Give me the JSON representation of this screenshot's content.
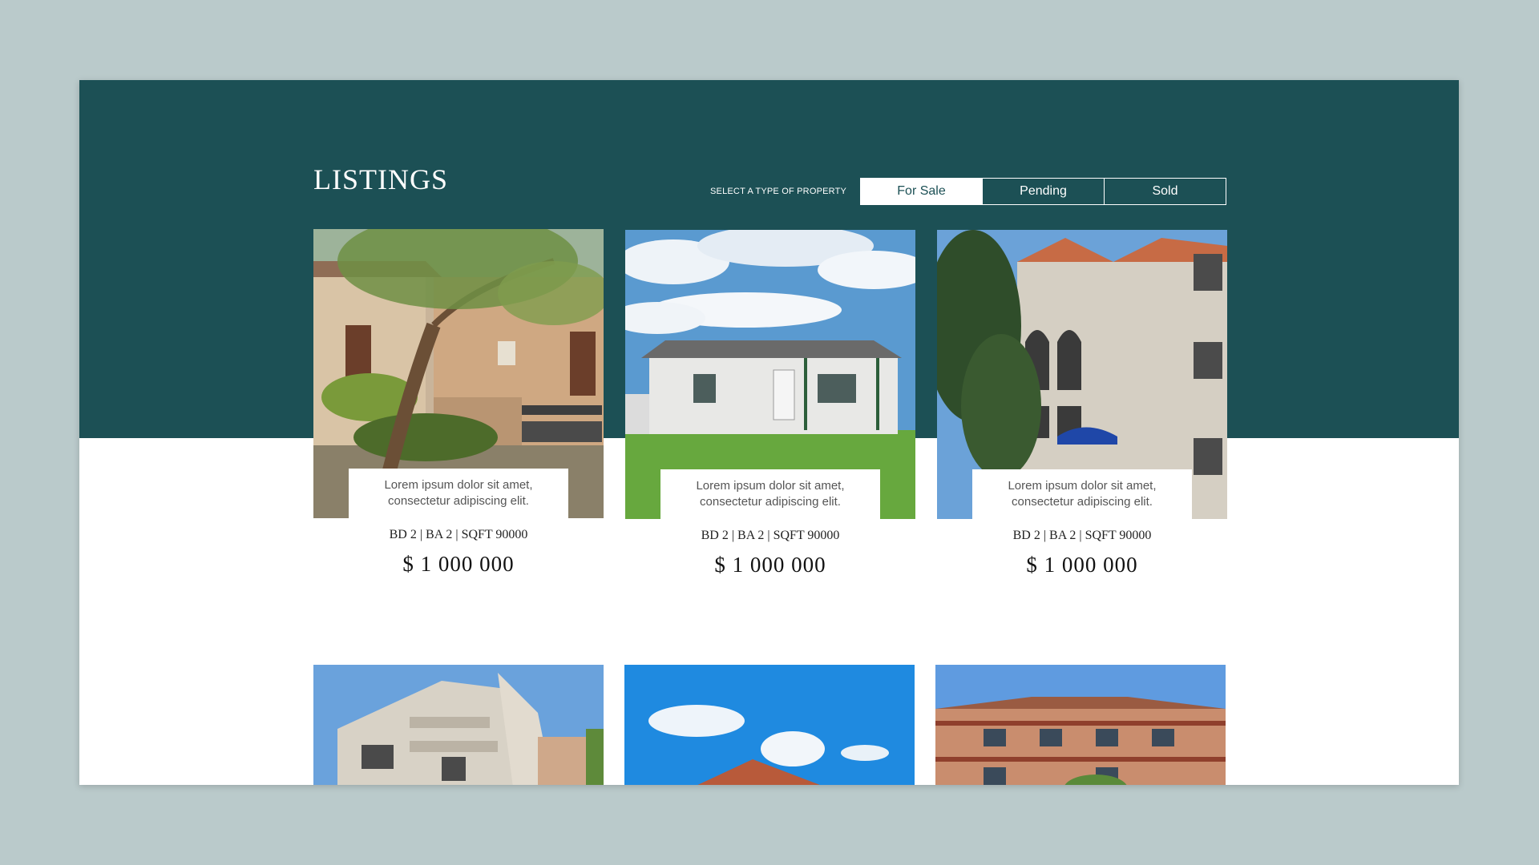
{
  "header": {
    "title": "LISTINGS",
    "filter_label": "SELECT A TYPE OF PROPERTY",
    "tabs": [
      {
        "label": "For Sale",
        "active": true
      },
      {
        "label": "Pending",
        "active": false
      },
      {
        "label": "Sold",
        "active": false
      }
    ]
  },
  "listings": [
    {
      "description": "Lorem ipsum dolor sit amet, consectetur adipiscing elit.",
      "specs": "BD 2  |  BA 2   |  SQFT 90000",
      "price": "$ 1 000 000"
    },
    {
      "description": "Lorem ipsum dolor sit amet, consectetur adipiscing elit.",
      "specs": "BD 2  |  BA 2   |  SQFT 90000",
      "price": "$ 1 000 000"
    },
    {
      "description": "Lorem ipsum dolor sit amet, consectetur adipiscing elit.",
      "specs": "BD 2  |  BA 2   |  SQFT 90000",
      "price": "$ 1 000 000"
    }
  ],
  "colors": {
    "page_background": "#bacacb",
    "header_band": "#1c5055",
    "card_background": "#ffffff",
    "text_dark": "#111111",
    "text_muted": "#555555"
  }
}
